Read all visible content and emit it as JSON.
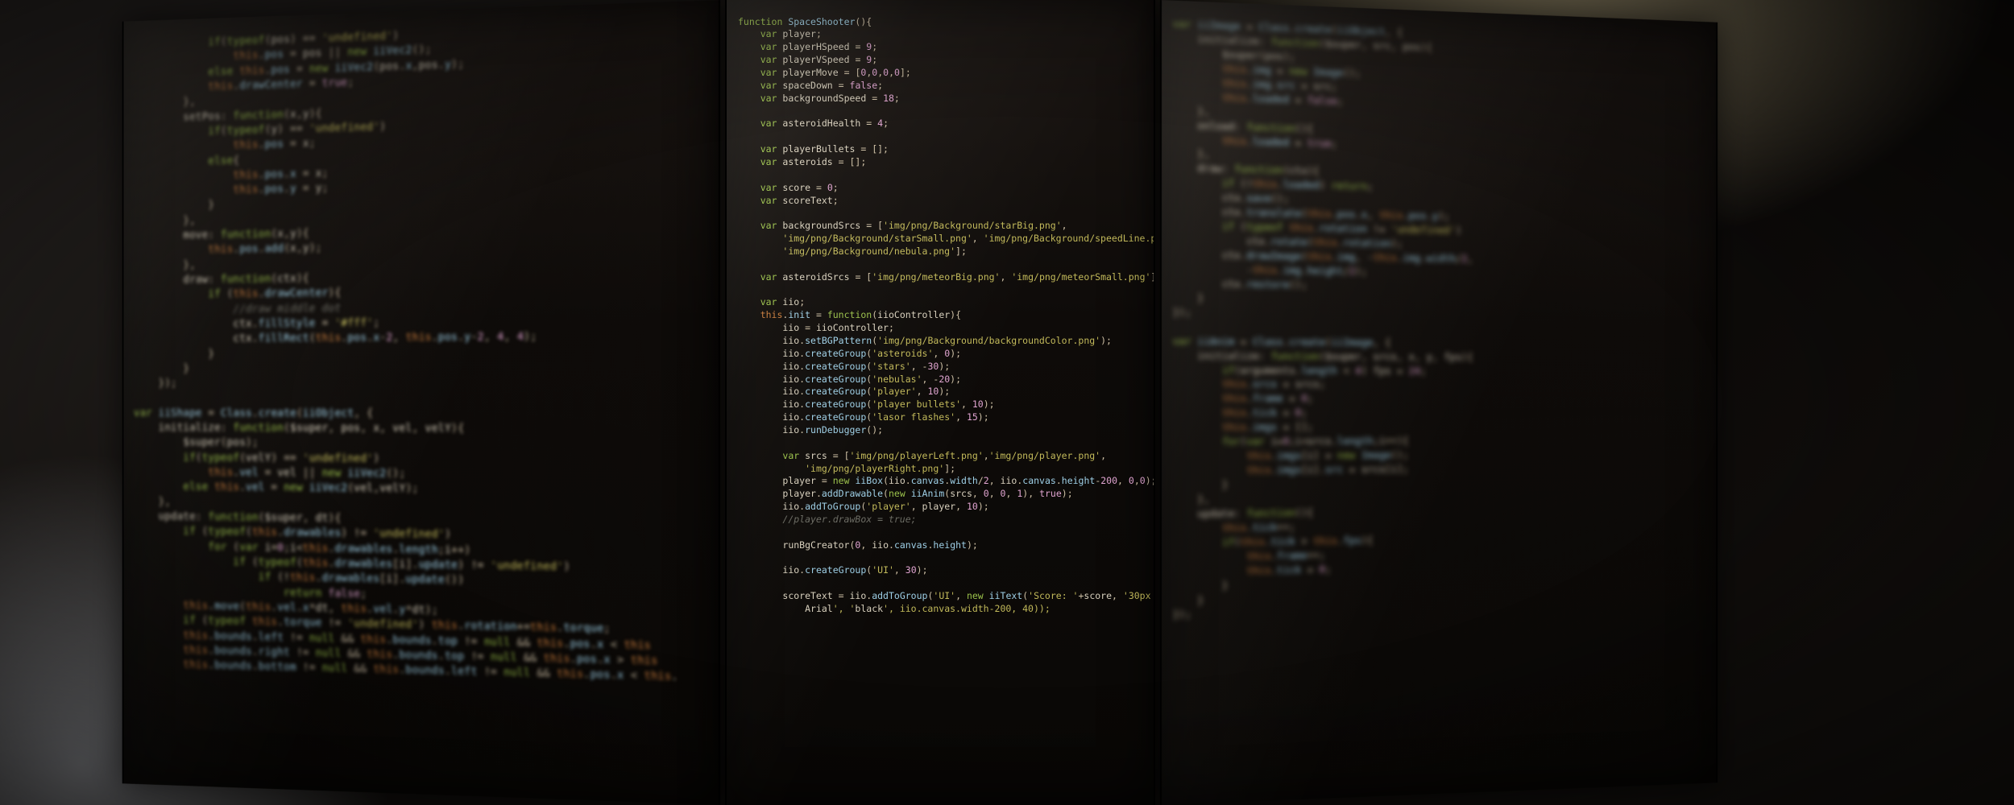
{
  "description": "Photograph of three adjacent computer monitors at an angle, each showing a dark-themed code editor with JavaScript source for a 'SpaceShooter' game. Left and right monitors are out of focus; center monitor is sharp. Warm ambient light from upper right; cool daylight spill from lower left.",
  "left_monitor": {
    "focus": "blurred",
    "lines": [
      "            if(typeof(pos) == 'undefined')",
      "                this.pos = pos || new iiVec2();",
      "            else this.pos = new iiVec2(pos.x,pos.y);",
      "            this.drawCenter = true;",
      "        },",
      "        setPos: function(x,y){",
      "            if(typeof(y) == 'undefined')",
      "                this.pos = x;",
      "            else{",
      "                this.pos.x = x;",
      "                this.pos.y = y;",
      "            }",
      "        },",
      "        move: function(x,y){",
      "            this.pos.add(x,y);",
      "        },",
      "        draw: function(ctx){",
      "            if (this.drawCenter){",
      "                //draw middle dot",
      "                ctx.fillStyle = '#fff';",
      "                ctx.fillRect(this.pos.x-2, this.pos.y-2, 4, 4);",
      "            }",
      "        }",
      "    });",
      "",
      "var iiShape = Class.create(iiObject, {",
      "    initialize: function($super, pos, x, vel, velY){",
      "        $super(pos);",
      "        if(typeof(velY) == 'undefined')",
      "            this.vel = vel || new iiVec2();",
      "        else this.vel = new iiVec2(vel,velY);",
      "    },",
      "    update: function($super, dt){",
      "        if (typeof(this.drawables) != 'undefined')",
      "            for (var i=0;i<this.drawables.length;i++)",
      "                if (typeof(this.drawables[i].update) != 'undefined')",
      "                    if (!this.drawables[i].update())",
      "                        return false;",
      "        this.move(this.vel.x*dt, this.vel.y*dt);",
      "        if (typeof this.torque != 'undefined') this.rotation+=this.torque;",
      "        this.bounds.left != null && this.bounds.top != null && this.pos.x < this",
      "        this.bounds.right != null && this.bounds.top != null && this.pos.x > this",
      "        this.bounds.bottom != null && this.bounds.left != null && this.pos.x < this."
    ]
  },
  "center_monitor": {
    "focus": "sharp",
    "lines": [
      "function SpaceShooter(){",
      "    var player;",
      "    var playerHSpeed = 9;",
      "    var playerVSpeed = 9;",
      "    var playerMove = [0,0,0,0];",
      "    var spaceDown = false;",
      "    var backgroundSpeed = 18;",
      "",
      "    var asteroidHealth = 4;",
      "",
      "    var playerBullets = [];",
      "    var asteroids = [];",
      "",
      "    var score = 0;",
      "    var scoreText;",
      "",
      "    var backgroundSrcs = ['img/png/Background/starBig.png',",
      "        'img/png/Background/starSmall.png', 'img/png/Background/speedLine.png',",
      "        'img/png/Background/nebula.png'];",
      "",
      "    var asteroidSrcs = ['img/png/meteorBig.png', 'img/png/meteorSmall.png'];",
      "",
      "    var iio;",
      "    this.init = function(iioController){",
      "        iio = iioController;",
      "        iio.setBGPattern('img/png/Background/backgroundColor.png');",
      "        iio.createGroup('asteroids', 0);",
      "        iio.createGroup('stars', -30);",
      "        iio.createGroup('nebulas', -20);",
      "        iio.createGroup('player', 10);",
      "        iio.createGroup('player bullets', 10);",
      "        iio.createGroup('lasor flashes', 15);",
      "        iio.runDebugger();",
      "",
      "        var srcs = ['img/png/playerLeft.png','img/png/player.png',",
      "            'img/png/playerRight.png'];",
      "        player = new iiBox(iio.canvas.width/2, iio.canvas.height-200, 0,0);",
      "        player.addDrawable(new iiAnim(srcs, 0, 0, 1), true);",
      "        iio.addToGroup('player', player, 10);",
      "        //player.drawBox = true;",
      "",
      "        runBgCreator(0, iio.canvas.height);",
      "",
      "        iio.createGroup('UI', 30);",
      "",
      "        scoreText = iio.addToGroup('UI', new iiText('Score: '+score, '30px",
      "            Arial', 'black', iio.canvas.width-200, 40));"
    ]
  },
  "right_monitor": {
    "focus": "heavily blurred",
    "lines": [
      "var iiImage = Class.create(iiObject, {",
      "    initialize: function($super, src, pos){",
      "        $super(pos);",
      "        this.img = new Image();",
      "        this.img.src = src;",
      "        this.loaded = false;",
      "    },",
      "    onload: function(){",
      "        this.loaded = true;",
      "    },",
      "    draw: function(ctx){",
      "        if (!this.loaded) return;",
      "        ctx.save();",
      "        ctx.translate(this.pos.x, this.pos.y);",
      "        if (typeof this.rotation != 'undefined')",
      "            ctx.rotate(this.rotation);",
      "        ctx.drawImage(this.img, -this.img.width/2,",
      "            -this.img.height/2);",
      "        ctx.restore();",
      "    }",
      "});",
      "",
      "var iiAnim = Class.create(iiImage, {",
      "    initialize: function($super, srcs, x, y, fps){",
      "        if(arguments.length < 4) fps = 24;",
      "        this.srcs = srcs;",
      "        this.frame = 0;",
      "        this.tick = 0;",
      "        this.imgs = [];",
      "        for(var i=0;i<srcs.length;i++){",
      "            this.imgs[i] = new Image();",
      "            this.imgs[i].src = srcs[i];",
      "        }",
      "    },",
      "    update: function(){",
      "        this.tick++;",
      "        if(this.tick > this.fps){",
      "            this.frame++;",
      "            this.tick = 0;",
      "        }",
      "    }",
      "});"
    ]
  }
}
